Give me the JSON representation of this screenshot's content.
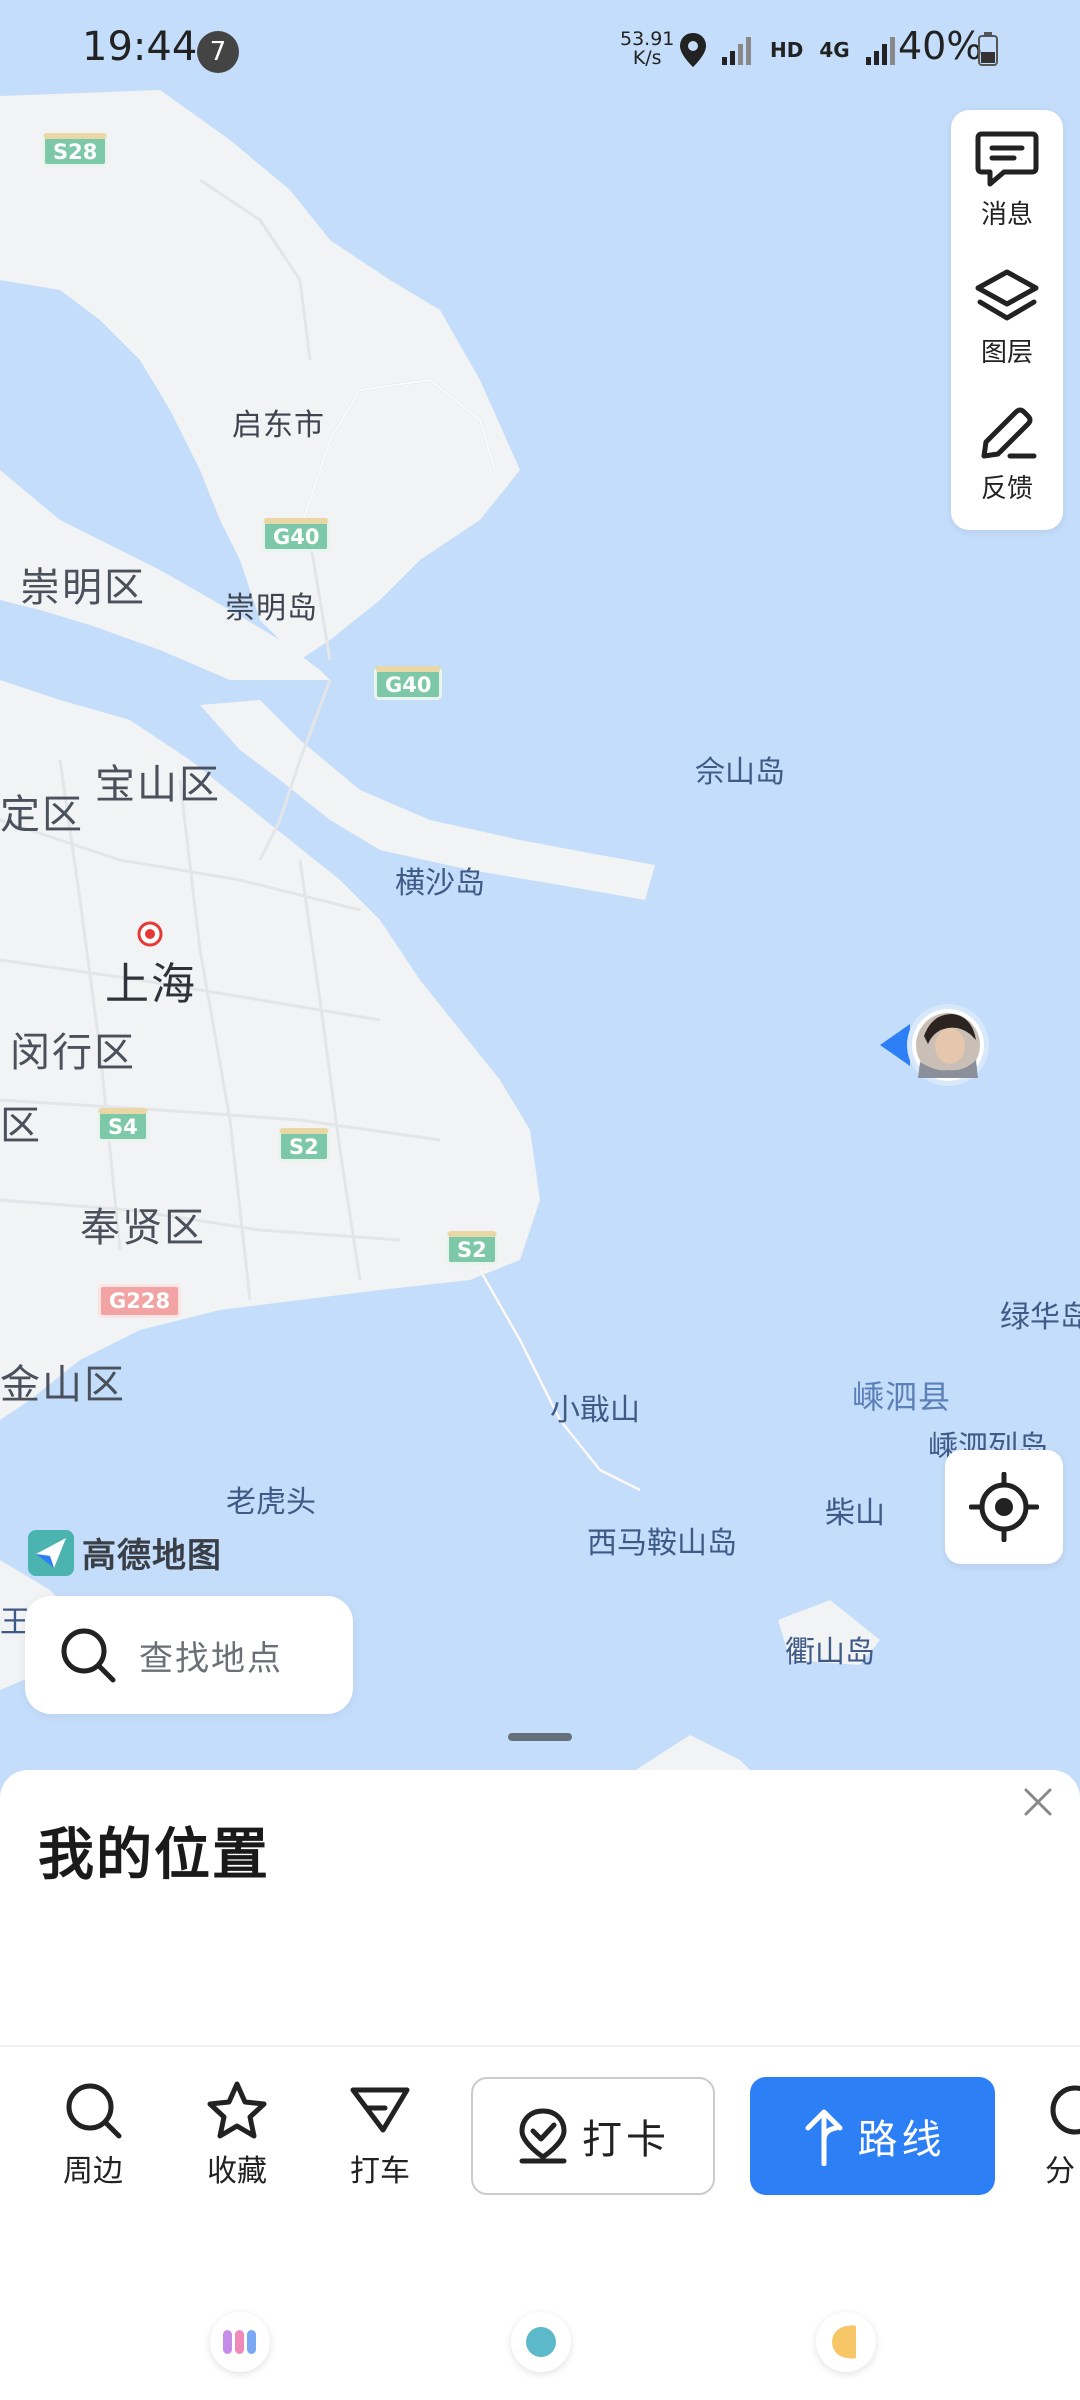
{
  "status_bar": {
    "time": "19:44",
    "notification_count": "7",
    "net_speed_value": "53.91",
    "net_speed_unit": "K/s",
    "hd": "HD",
    "network": "4G",
    "battery": "40%"
  },
  "map": {
    "places": {
      "qidong": "启东市",
      "chongming_district": "崇明区",
      "chongming_island": "崇明岛",
      "baoshan": "宝山区",
      "jiading_partial": "定区",
      "shanghai": "上海",
      "minhang": "闵行区",
      "partial_qu": "区",
      "fengxian": "奉贤区",
      "jinshan": "金山区",
      "laohutou": "老虎头",
      "hengsha": "横沙岛",
      "sheshan": "佘山岛",
      "xiaojishan": "小戢山",
      "ximaanshan": "西马鞍山岛",
      "chaishan": "柴山",
      "qushan": "衢山岛",
      "lvhua": "绿华岛",
      "shengsi_county": "嵊泗县",
      "shengsi_islands": "嵊泗列岛",
      "partial_left": "王盘"
    },
    "shields": {
      "s28": "S28",
      "g40_a": "G40",
      "g40_b": "G40",
      "s4": "S4",
      "s2_a": "S2",
      "s2_b": "S2",
      "g228": "G228"
    },
    "logo_text": "高德地图",
    "colors": {
      "sea": "#c4ddfa",
      "land": "#f2f3f4"
    }
  },
  "tools": {
    "messages": "消息",
    "layers": "图层",
    "feedback": "反馈"
  },
  "search": {
    "placeholder": "查找地点"
  },
  "sheet": {
    "title": "我的位置",
    "actions": {
      "nearby": "周边",
      "favorite": "收藏",
      "taxi": "打车",
      "checkin": "打卡",
      "route": "路线",
      "share_partial": "分"
    },
    "colors": {
      "route_bg": "#2d7ff6"
    }
  }
}
